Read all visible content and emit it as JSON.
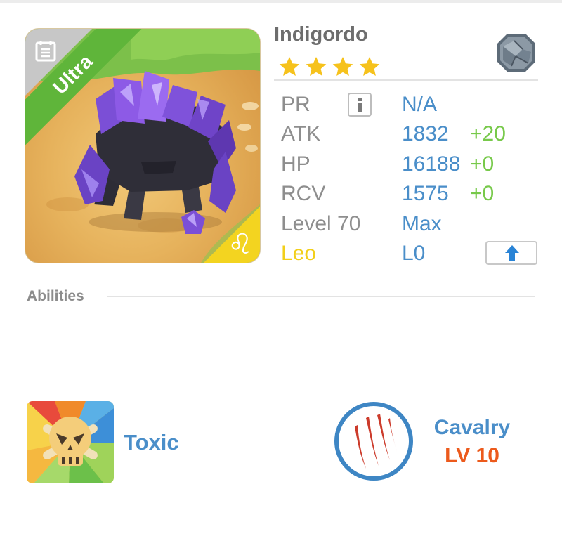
{
  "monster": {
    "name": "Indigordo",
    "stars": 4,
    "rarity": "Ultra",
    "element_icon": "rock-element-icon",
    "sign_icon": "leo-zodiac-icon",
    "notes_icon": "notes-icon"
  },
  "stats": {
    "pr": {
      "label": "PR",
      "value": "N/A"
    },
    "atk": {
      "label": "ATK",
      "value": "1832",
      "bonus": "+20"
    },
    "hp": {
      "label": "HP",
      "value": "16188",
      "bonus": "+0"
    },
    "rcv": {
      "label": "RCV",
      "value": "1575",
      "bonus": "+0"
    },
    "level": {
      "label": "Level 70",
      "value": "Max"
    },
    "sign": {
      "label": "Leo",
      "value": "L0"
    }
  },
  "abilities": {
    "title": "Abilities",
    "trait": {
      "name": "Toxic",
      "icon": "skull-icon"
    },
    "skill": {
      "name": "Cavalry",
      "level": "LV 10",
      "icon": "claw-marks-icon"
    }
  },
  "colors": {
    "accent_blue": "#4a8ec9",
    "bonus_green": "#77c94a",
    "rarity_green": "#5fb53a",
    "sign_yellow": "#f2cf1a",
    "level_orange": "#ec5a1c",
    "label_gray": "#8e8e8e"
  }
}
